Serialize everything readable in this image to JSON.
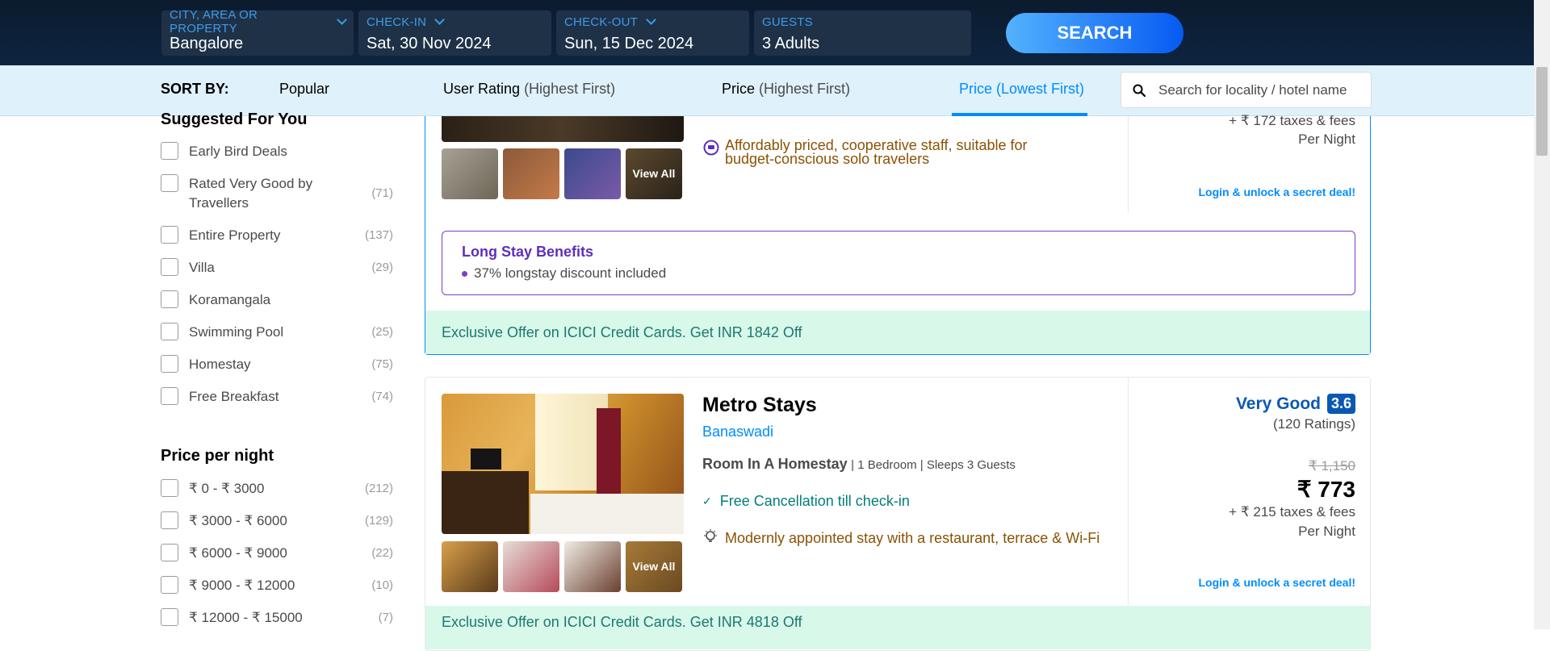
{
  "search_bar": {
    "city": {
      "label": "CITY, AREA OR PROPERTY",
      "value": "Bangalore"
    },
    "checkin": {
      "label": "CHECK-IN",
      "value": "Sat, 30 Nov 2024"
    },
    "checkout": {
      "label": "CHECK-OUT",
      "value": "Sun, 15 Dec 2024"
    },
    "guests": {
      "label": "GUESTS",
      "value": "3 Adults"
    },
    "search_label": "SEARCH"
  },
  "sort_bar": {
    "label": "SORT BY:",
    "options": [
      {
        "main": "Popular",
        "sub": ""
      },
      {
        "main": "User Rating",
        "sub": "(Highest First)"
      },
      {
        "main": "Price",
        "sub": "(Highest First)"
      },
      {
        "main": "Price",
        "sub": "(Lowest First)"
      }
    ],
    "active_index": 3,
    "search_placeholder": "Search for locality / hotel name"
  },
  "sidebar": {
    "suggested_heading": "Suggested For You",
    "suggested": [
      {
        "label": "Early Bird Deals",
        "count": ""
      },
      {
        "label": "Rated Very Good by Travellers",
        "count": "(71)"
      },
      {
        "label": "Entire Property",
        "count": "(137)"
      },
      {
        "label": "Villa",
        "count": "(29)"
      },
      {
        "label": "Koramangala",
        "count": ""
      },
      {
        "label": "Swimming Pool",
        "count": "(25)"
      },
      {
        "label": "Homestay",
        "count": "(75)"
      },
      {
        "label": "Free Breakfast",
        "count": "(74)"
      }
    ],
    "price_heading": "Price per night",
    "price_ranges": [
      {
        "label": "₹ 0 - ₹ 3000",
        "count": "(212)"
      },
      {
        "label": "₹ 3000 - ₹ 6000",
        "count": "(129)"
      },
      {
        "label": "₹ 6000 - ₹ 9000",
        "count": "(22)"
      },
      {
        "label": "₹ 9000 - ₹ 12000",
        "count": "(10)"
      },
      {
        "label": "₹ 12000 - ₹ 15000",
        "count": "(7)"
      }
    ]
  },
  "card1": {
    "usp": "Affordably priced, cooperative staff, suitable for budget-conscious solo travelers",
    "view_all": "View All",
    "taxes": "+ ₹ 172 taxes & fees",
    "per_night": "Per Night",
    "login_deal": "Login & unlock a secret deal!",
    "long_stay_title": "Long Stay Benefits",
    "long_stay_item": "37% longstay discount included",
    "offer": "Exclusive Offer on ICICI Credit Cards. Get INR 1842 Off"
  },
  "card2": {
    "name": "Metro Stays",
    "locality": "Banaswadi",
    "room_type": "Room In A Homestay",
    "room_details": "| 1 Bedroom | Sleeps 3 Guests",
    "cancellation": "Free Cancellation till check-in",
    "usp": "Modernly appointed stay with a restaurant, terrace & Wi-Fi",
    "view_all": "View All",
    "rating_text": "Very Good",
    "rating_score": "3.6",
    "rating_count": "(120 Ratings)",
    "original_price": "₹ 1,150",
    "price": "₹ 773",
    "taxes": "+ ₹ 215 taxes & fees",
    "per_night": "Per Night",
    "login_deal": "Login & unlock a secret deal!",
    "offer": "Exclusive Offer on ICICI Credit Cards. Get INR 4818 Off"
  },
  "colors": {
    "topbar": "#0d2440",
    "accent": "#008cff",
    "sortbar_bg": "#dff1fb",
    "offer_bg": "#d8f8ea",
    "offer_text": "#1a7971",
    "long_stay": "#5e2eba",
    "usp_text": "#8a5204",
    "cancellation": "#007e7d",
    "rating_badge": "#0b58b4"
  }
}
